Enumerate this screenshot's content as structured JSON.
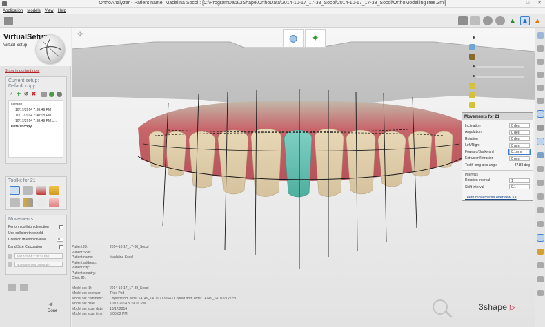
{
  "window": {
    "title": "OrthoAnalyzer - Patient name: Madalina Socol : [C:\\ProgramData\\3Shape\\OrthoData\\2014-10-17_17-38_Socol\\2014-10-17_17-38_Socol\\OrthoModellingTree.3ml]",
    "minimize": "—",
    "maximize": "□",
    "close": "✕"
  },
  "menu": [
    "Application",
    "Models",
    "View",
    "Help"
  ],
  "left": {
    "title": "VirtualSetup",
    "subtitle": "Virtual Setup",
    "show_note": "Show important note",
    "current_setup_label": "Current setup:",
    "current_setup_value": "Default copy",
    "setup_tools": [
      "✓",
      "✚",
      "↺",
      "✖"
    ],
    "tree": [
      {
        "text": "Default",
        "bold": false,
        "indent": false
      },
      {
        "text": "10/17/2014  7:38:49 PM",
        "bold": false,
        "indent": true
      },
      {
        "text": "10/17/2014  7:40:18 PM",
        "bold": false,
        "indent": true
      },
      {
        "text": "10/17/2014  7:38:49 PM c...",
        "bold": false,
        "indent": true
      },
      {
        "text": "Default copy",
        "bold": true,
        "indent": false
      }
    ],
    "toolkit_title": "Toolkit for 21",
    "movements_title": "Movements",
    "perform_collision": "Perform collision detection",
    "use_threshold": "Use collision threshold",
    "threshold_label": "Collision threshold value",
    "threshold_value": "0",
    "band_size": "Band Size Calculation",
    "date_select": "10/17/2014 7:39:24 PM",
    "movement_select": "No movement constrain",
    "done": "Done"
  },
  "viewport": {
    "movements_panel": {
      "title": "Movements for 21",
      "rows": [
        {
          "label": "Inclination",
          "value": "0 deg",
          "field": true
        },
        {
          "label": "Angulation",
          "value": "0 deg",
          "field": true
        },
        {
          "label": "Rotation",
          "value": "0 deg",
          "field": true
        },
        {
          "label": "Left/Right",
          "value": "0 mm",
          "field": true
        },
        {
          "label": "Forward/Backward",
          "value": "0.1mm",
          "field": true
        },
        {
          "label": "Extrusion/Intrusion",
          "value": "0 mm",
          "field": true
        },
        {
          "label": "Tooth long axis angle",
          "value": "87.88 deg",
          "field": false
        }
      ],
      "intervals_label": "Intervals",
      "interval_rows": [
        {
          "label": "Rotation interval",
          "value": "1"
        },
        {
          "label": "Shift interval",
          "value": "0.1"
        }
      ],
      "link": "Teeth movements overview >>"
    },
    "patient": [
      {
        "label": "Patient ID:",
        "value": "2014-10-17_17-38_Socol"
      },
      {
        "label": "Patient SSN:",
        "value": ""
      },
      {
        "label": "Patient name:",
        "value": "Madalina Socol"
      },
      {
        "label": "Patient address:",
        "value": ""
      },
      {
        "label": "Patient city:",
        "value": ""
      },
      {
        "label": "Patient country:",
        "value": ""
      },
      {
        "label": "Clinic ID:",
        "value": ""
      }
    ],
    "model": [
      {
        "label": "Model set ID:",
        "value": "2014-10-17_17-38_Socol"
      },
      {
        "label": "Model set operator:",
        "value": "Trios Pod"
      },
      {
        "label": "Model set comment:",
        "value": "Copied from order 14149_141017135543 Copied from order 14149_141017122750"
      },
      {
        "label": "Model set date:",
        "value": "10/17/2014 5:39:16 PM"
      },
      {
        "label": "Model set scan date:",
        "value": "10/17/2014"
      },
      {
        "label": "Model set scan time:",
        "value": "5:05:02 PM"
      }
    ],
    "brand": "3shape",
    "brand_mark": "▷"
  },
  "colors": {
    "accent_blue": "#3c7fd1",
    "selected_tooth": "#5fbcb0",
    "gingiva": "#c8656a",
    "brand_red": "#c8102e"
  }
}
